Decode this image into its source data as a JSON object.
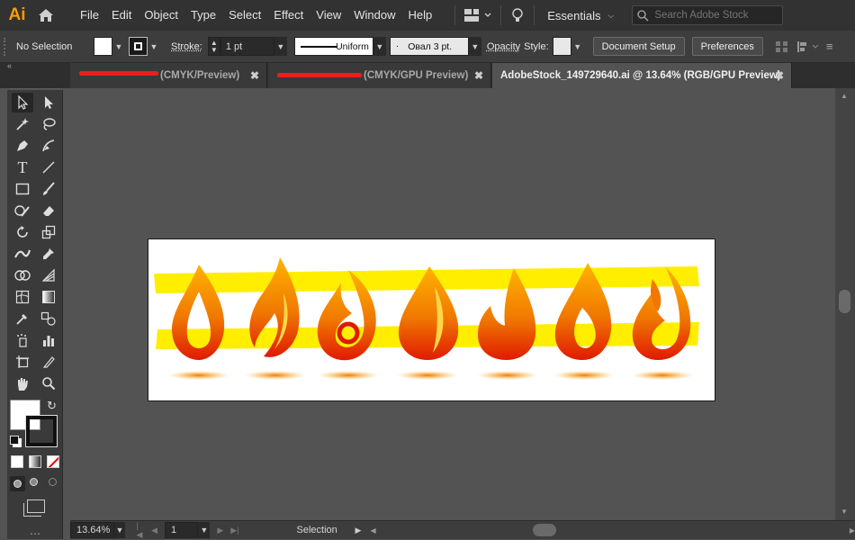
{
  "app": {
    "logo": "Ai"
  },
  "menu": [
    "File",
    "Edit",
    "Object",
    "Type",
    "Select",
    "Effect",
    "View",
    "Window",
    "Help"
  ],
  "workspace": {
    "label": "Essentials"
  },
  "search": {
    "placeholder": "Search Adobe Stock"
  },
  "control": {
    "selection": "No Selection",
    "stroke_label": "Stroke:",
    "stroke_value": "1 pt",
    "stroke_profile": "Uniform",
    "brush": "Овал 3 pt.",
    "opacity_label": "Opacity",
    "style_label": "Style:",
    "document_setup": "Document Setup",
    "preferences": "Preferences"
  },
  "tabs": [
    {
      "label": "(CMYK/Preview)",
      "active": false
    },
    {
      "label": "(CMYK/GPU Preview)",
      "active": false
    },
    {
      "label": "AdobeStock_149729640.ai @ 13.64% (RGB/GPU Preview)",
      "active": true
    }
  ],
  "status": {
    "zoom": "13.64%",
    "artboard": "1",
    "tool": "Selection"
  },
  "colors": {
    "accent": "#ff9a00",
    "redaction": "#ee1c1c",
    "highlight": "#ffee00",
    "flame_orange": "#f07800",
    "flame_red": "#e01a00"
  },
  "icons": [
    "home-icon",
    "workspace-grid-icon",
    "lightbulb-icon",
    "search-icon",
    "selection-tool-icon",
    "direct-selection-tool-icon",
    "magic-wand-icon",
    "lasso-icon",
    "pen-icon",
    "curvature-icon",
    "type-icon",
    "line-icon",
    "rectangle-icon",
    "paintbrush-icon",
    "shaper-icon",
    "eraser-icon",
    "rotate-icon",
    "scale-icon",
    "width-icon",
    "free-transform-icon",
    "shape-builder-icon",
    "perspective-grid-icon",
    "mesh-icon",
    "gradient-icon",
    "eyedropper-icon",
    "blend-icon",
    "symbol-sprayer-icon",
    "column-graph-icon",
    "artboard-icon",
    "slice-icon",
    "hand-icon",
    "zoom-icon"
  ]
}
